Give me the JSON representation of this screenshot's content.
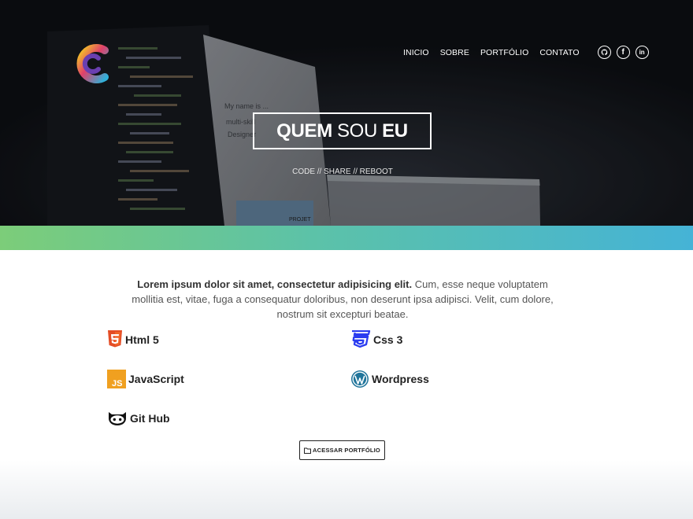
{
  "nav": {
    "items": [
      {
        "label": "INICIO"
      },
      {
        "label": "SOBRE"
      },
      {
        "label": "PORTFÓLIO"
      },
      {
        "label": "CONTATO"
      }
    ],
    "social": [
      "github-icon",
      "facebook-icon",
      "linkedin-icon"
    ]
  },
  "hero": {
    "title_a": "QUEM",
    "title_b": "SOU",
    "title_c": "EU",
    "tagline": "CODE // SHARE // REBOOT",
    "screen_text": "My name is ...\nmulti-skill\nDesigner",
    "screen_button": "PROJET"
  },
  "intro": {
    "bold": "Lorem ipsum dolor sit amet, consectetur adipisicing elit.",
    "rest": " Cum, esse neque voluptatem mollitia est, vitae, fuga a consequatur doloribus, non deserunt ipsa adipisci. Velit, cum dolore, nostrum sit excepturi beatae."
  },
  "skills": {
    "html": "Html 5",
    "css": "Css 3",
    "js": "JavaScript",
    "wp": "Wordpress",
    "gh": "Git Hub",
    "js_badge": "JS"
  },
  "button": {
    "label": "ACESSAR PORTFÓLIO"
  },
  "colors": {
    "band_start": "#7ccd79",
    "band_end": "#45b3d6",
    "html_orange": "#e44d26",
    "css_blue": "#2a3cf0",
    "js_yellow": "#f0a020",
    "wp_blue": "#21759b"
  }
}
